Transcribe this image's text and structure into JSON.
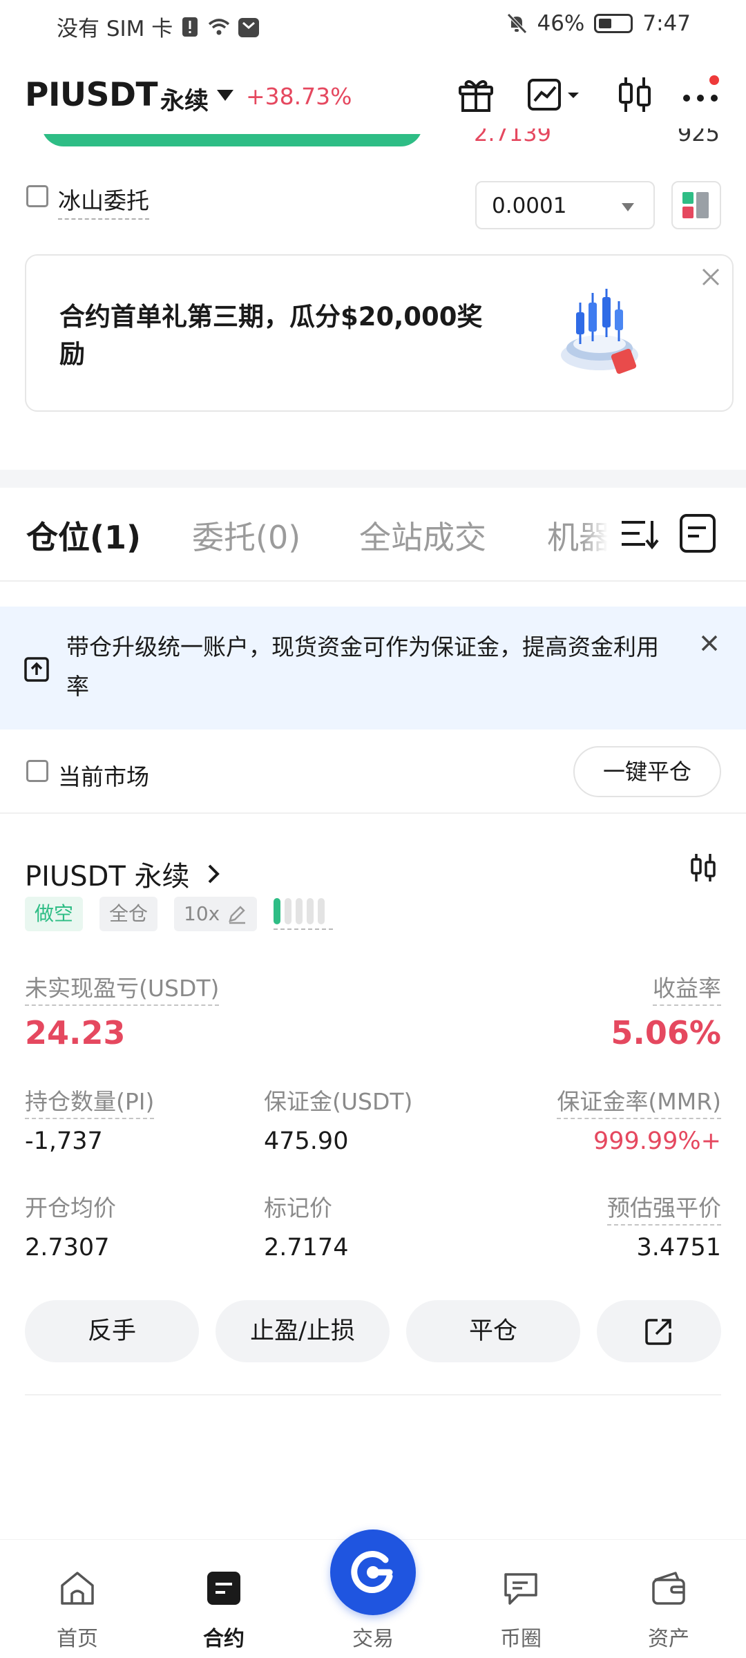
{
  "status_bar": {
    "carrier": "没有 SIM 卡",
    "battery": "46%",
    "time": "7:47"
  },
  "header": {
    "symbol": "PIUSDT",
    "contract_type": "永续",
    "change": "+38.73%"
  },
  "orderbook_peek": {
    "price": "2.7139",
    "qty": "925"
  },
  "order_options": {
    "iceberg_label": "冰山委托",
    "precision_value": "0.0001"
  },
  "banner": {
    "text": "合约首单礼第三期，瓜分$20,000奖励"
  },
  "tabs": [
    {
      "label": "仓位(1)",
      "active": true
    },
    {
      "label": "委托(0)",
      "active": false
    },
    {
      "label": "全站成交",
      "active": false
    },
    {
      "label": "机器人",
      "active": false
    }
  ],
  "notice": {
    "text": "带仓升级统一账户，现货资金可作为保证金，提高资金利用率"
  },
  "filter": {
    "current_market_label": "当前市场",
    "close_all_label": "一键平仓"
  },
  "position": {
    "title": "PIUSDT 永续",
    "side_tag": "做空",
    "margin_mode_tag": "全仓",
    "leverage_tag": "10x",
    "adl_level": 1,
    "unrealized_pnl_label": "未实现盈亏(USDT)",
    "unrealized_pnl_value": "24.23",
    "roe_label": "收益率",
    "roe_value": "5.06%",
    "size_label": "持仓数量(PI)",
    "size_value": "-1,737",
    "margin_label": "保证金(USDT)",
    "margin_value": "475.90",
    "mmr_label": "保证金率(MMR)",
    "mmr_value": "999.99%+",
    "entry_label": "开仓均价",
    "entry_value": "2.7307",
    "mark_label": "标记价",
    "mark_value": "2.7174",
    "liq_label": "预估强平价",
    "liq_value": "3.4751",
    "actions": {
      "reverse": "反手",
      "tpsl": "止盈/止损",
      "close": "平仓"
    }
  },
  "bottom_nav": [
    {
      "label": "首页",
      "icon": "home-icon",
      "active": false
    },
    {
      "label": "合约",
      "icon": "futures-icon",
      "active": true
    },
    {
      "label": "交易",
      "icon": "trade-icon",
      "active": false
    },
    {
      "label": "币圈",
      "icon": "community-icon",
      "active": false
    },
    {
      "label": "资产",
      "icon": "wallet-icon",
      "active": false
    }
  ],
  "colors": {
    "up": "#2ebd85",
    "down": "#e5485f",
    "accent": "#1f55e0",
    "notice_bg": "#eef5ff"
  }
}
